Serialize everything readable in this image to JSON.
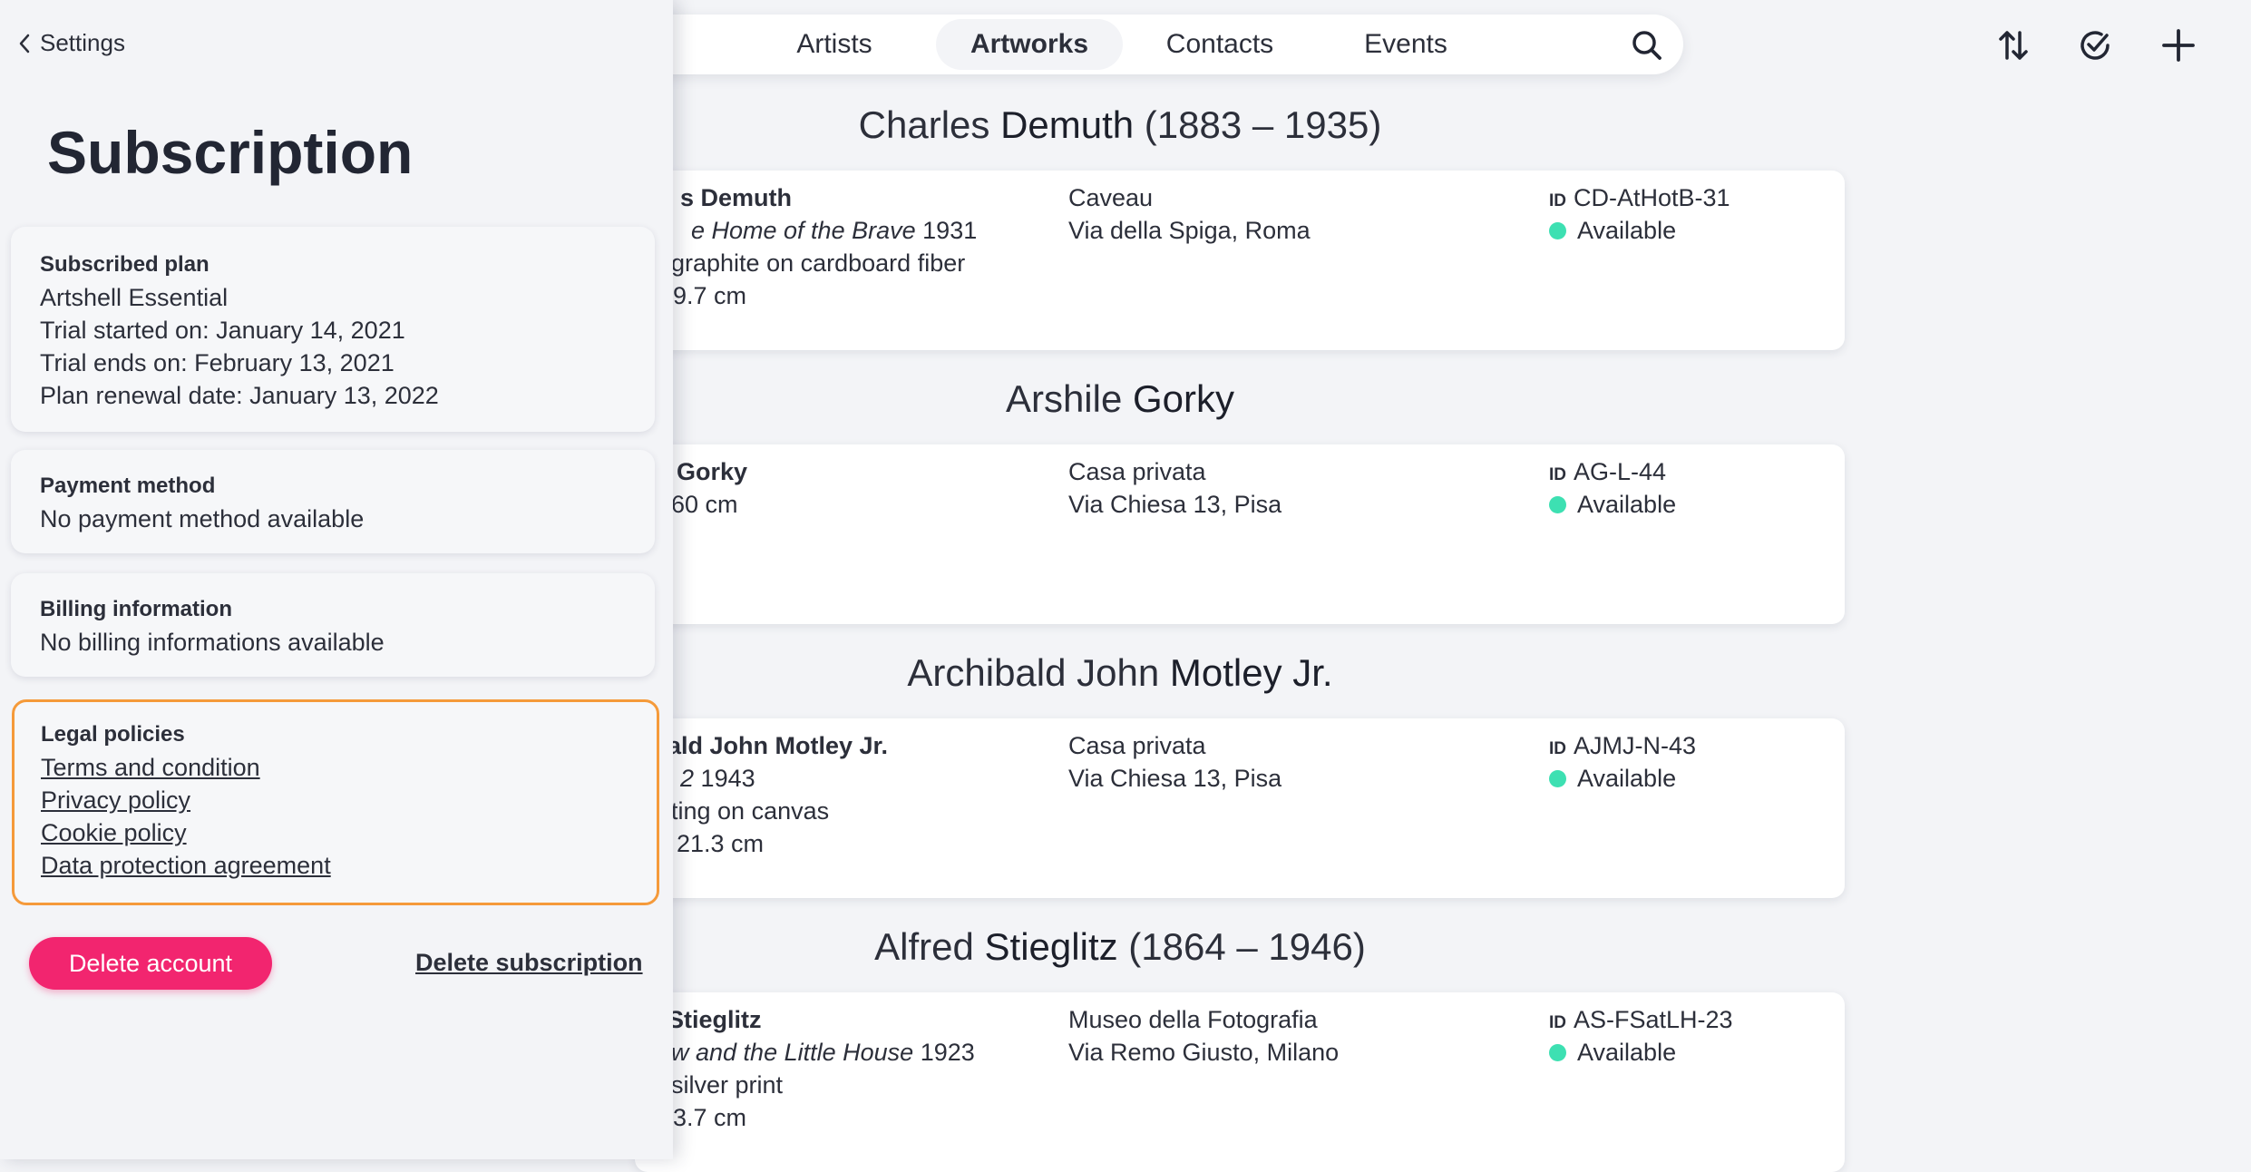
{
  "nav": {
    "tabs": [
      {
        "label": "Artists",
        "active": false
      },
      {
        "label": "Artworks",
        "active": true
      },
      {
        "label": "Contacts",
        "active": false
      },
      {
        "label": "Events",
        "active": false
      }
    ],
    "icons": [
      "search-icon",
      "sort-icon",
      "check-circle-icon",
      "plus-icon"
    ]
  },
  "artists": [
    {
      "first": "Charles",
      "last": "Demuth",
      "dates": "(1883 – 1935)",
      "card": {
        "name": "s Demuth",
        "title_italic": "e Home of the Brave",
        "year": "1931",
        "medium": "graphite on cardboard fiber",
        "size": "9.7 cm",
        "location": "Caveau",
        "address": "Via della Spiga, Roma",
        "id_label": "ID",
        "id": "CD-AtHotB-31",
        "status": "Available"
      }
    },
    {
      "first": "Arshile",
      "last": "Gorky",
      "dates": "",
      "card": {
        "name": "Gorky",
        "size": "60 cm",
        "location": "Casa privata",
        "address": "Via Chiesa 13, Pisa",
        "id_label": "ID",
        "id": "AG-L-44",
        "status": "Available"
      }
    },
    {
      "first": "Archibald John",
      "last": "Motley Jr.",
      "dates": "",
      "card": {
        "name": "ald John Motley Jr.",
        "title_italic": "2",
        "year": "1943",
        "medium": "ting on canvas",
        "size": "21.3 cm",
        "location": "Casa privata",
        "address": "Via Chiesa 13, Pisa",
        "id_label": "ID",
        "id": "AJMJ-N-43",
        "status": "Available"
      }
    },
    {
      "first": "Alfred",
      "last": "Stieglitz",
      "dates": "(1864 – 1946)",
      "card": {
        "name": "Stieglitz",
        "title_italic": "w and the Little House",
        "year": "1923",
        "medium": "silver print",
        "size": "3.7 cm",
        "location": "Museo della Fotografia",
        "address": "Via Remo Giusto, Milano",
        "id_label": "ID",
        "id": "AS-FSatLH-23",
        "status": "Available"
      }
    }
  ],
  "panel": {
    "back_label": "Settings",
    "title": "Subscription",
    "plan": {
      "header": "Subscribed plan",
      "name": "Artshell Essential",
      "trial_start": "Trial started on: January 14, 2021",
      "trial_end": "Trial ends on: February 13, 2021",
      "renewal": "Plan renewal date: January 13, 2022"
    },
    "payment": {
      "header": "Payment method",
      "value": "No payment method available"
    },
    "billing": {
      "header": "Billing information",
      "value": "No billing informations available"
    },
    "legal": {
      "header": "Legal policies",
      "links": [
        "Terms and condition",
        "Privacy policy",
        "Cookie policy",
        "Data protection agreement"
      ]
    },
    "delete_account": "Delete account",
    "delete_subscription": "Delete subscription"
  },
  "colors": {
    "background": "#f3f4f7",
    "accent_pink": "#f2256f",
    "status_available": "#3de0b2",
    "highlight_border": "#f59a3a"
  }
}
